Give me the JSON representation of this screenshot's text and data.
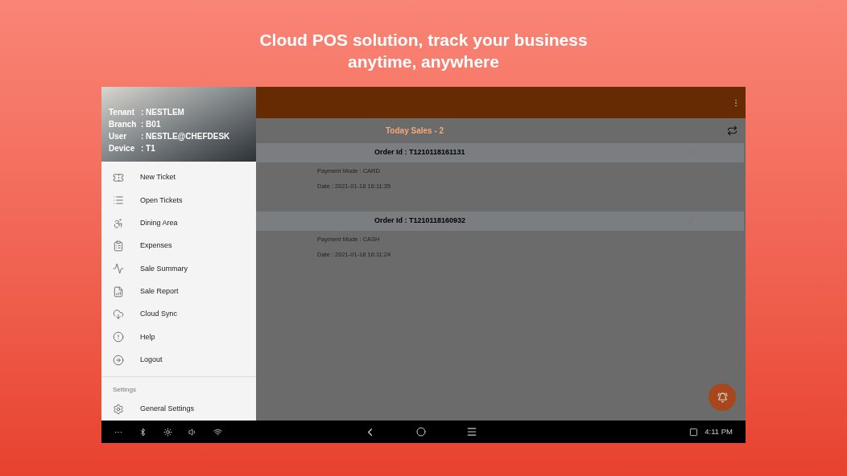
{
  "headline": [
    "Cloud POS solution, track your business",
    "anytime, anywhere"
  ],
  "drawer": {
    "header": [
      {
        "label": "Tenant",
        "value": ": NESTLEM"
      },
      {
        "label": "Branch",
        "value": ": B01"
      },
      {
        "label": "User",
        "value": ": NESTLE@CHEFDESK"
      },
      {
        "label": "Device",
        "value": ": T1"
      }
    ],
    "items": [
      {
        "label": "New Ticket"
      },
      {
        "label": "Open Tickets"
      },
      {
        "label": "Dining Area"
      },
      {
        "label": "Expenses"
      },
      {
        "label": "Sale Summary"
      },
      {
        "label": "Sale Report"
      },
      {
        "label": "Cloud Sync"
      },
      {
        "label": "Help"
      },
      {
        "label": "Logout"
      }
    ],
    "section": "Settings",
    "section_items": [
      {
        "label": "General Settings"
      }
    ]
  },
  "sales_title": "Today Sales - 2",
  "orders": [
    {
      "order_id": "Order Id : T1210118161131",
      "payment": "Payment Mode : CARD",
      "date": "Date : 2021-01-18 16:11:35"
    },
    {
      "order_id": "Order Id : T1210118160932",
      "payment": "Payment Mode : CASH",
      "date": "Date : 2021-01-18 16:11:24"
    }
  ],
  "status_bar": {
    "more": "···",
    "time": "4:11 PM"
  }
}
